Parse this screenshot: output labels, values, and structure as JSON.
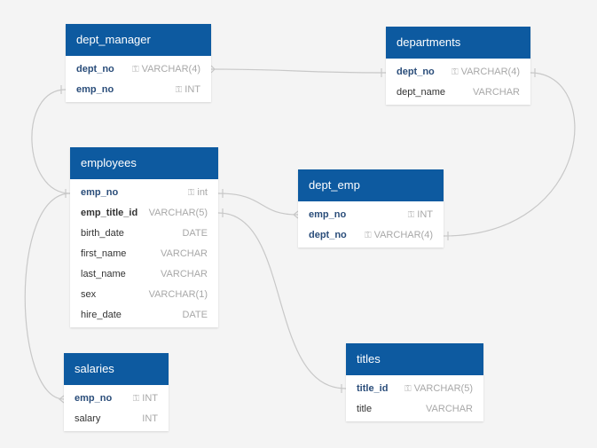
{
  "colors": {
    "header_bg": "#0d5aa0",
    "header_text": "#ffffff",
    "pk_text": "#2a4d7a",
    "type_text": "#a8a8a8",
    "connector": "#c8c8c8",
    "canvas_bg": "#f4f4f4"
  },
  "icons": {
    "key": "key-icon"
  },
  "tables": {
    "dept_manager": {
      "name": "dept_manager",
      "columns": [
        {
          "name": "dept_no",
          "type": "VARCHAR(4)",
          "key": true
        },
        {
          "name": "emp_no",
          "type": "INT",
          "key": true
        }
      ]
    },
    "departments": {
      "name": "departments",
      "columns": [
        {
          "name": "dept_no",
          "type": "VARCHAR(4)",
          "key": true
        },
        {
          "name": "dept_name",
          "type": "VARCHAR",
          "key": false
        }
      ]
    },
    "employees": {
      "name": "employees",
      "columns": [
        {
          "name": "emp_no",
          "type": "int",
          "key": true
        },
        {
          "name": "emp_title_id",
          "type": "VARCHAR(5)",
          "key": false
        },
        {
          "name": "birth_date",
          "type": "DATE",
          "key": false
        },
        {
          "name": "first_name",
          "type": "VARCHAR",
          "key": false
        },
        {
          "name": "last_name",
          "type": "VARCHAR",
          "key": false
        },
        {
          "name": "sex",
          "type": "VARCHAR(1)",
          "key": false
        },
        {
          "name": "hire_date",
          "type": "DATE",
          "key": false
        }
      ]
    },
    "dept_emp": {
      "name": "dept_emp",
      "columns": [
        {
          "name": "emp_no",
          "type": "INT",
          "key": true
        },
        {
          "name": "dept_no",
          "type": "VARCHAR(4)",
          "key": true
        }
      ]
    },
    "salaries": {
      "name": "salaries",
      "columns": [
        {
          "name": "emp_no",
          "type": "INT",
          "key": true
        },
        {
          "name": "salary",
          "type": "INT",
          "key": false
        }
      ]
    },
    "titles": {
      "name": "titles",
      "columns": [
        {
          "name": "title_id",
          "type": "VARCHAR(5)",
          "key": true
        },
        {
          "name": "title",
          "type": "VARCHAR",
          "key": false
        }
      ]
    }
  },
  "relationships": [
    {
      "from": "dept_manager.dept_no",
      "to": "departments.dept_no"
    },
    {
      "from": "dept_manager.emp_no",
      "to": "employees.emp_no"
    },
    {
      "from": "employees.emp_no",
      "to": "dept_emp.emp_no"
    },
    {
      "from": "departments.dept_no",
      "to": "dept_emp.dept_no"
    },
    {
      "from": "employees.emp_no",
      "to": "salaries.emp_no"
    },
    {
      "from": "employees.emp_title_id",
      "to": "titles.title_id"
    }
  ]
}
